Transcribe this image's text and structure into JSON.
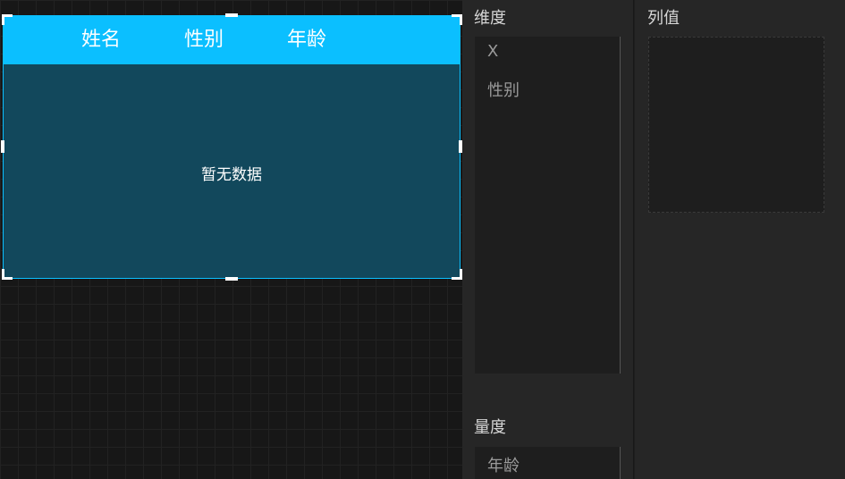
{
  "table": {
    "columns": [
      "姓名",
      "性别",
      "年龄"
    ],
    "empty_text": "暂无数据"
  },
  "dimension_panel": {
    "title": "维度",
    "items": [
      "X",
      "性别"
    ]
  },
  "measure_panel": {
    "title": "量度",
    "items": [
      "年龄"
    ]
  },
  "column_panel": {
    "title": "列值"
  },
  "colors": {
    "header_bg": "#0bbfff",
    "body_bg": "#12485c",
    "panel_bg": "#262626"
  }
}
